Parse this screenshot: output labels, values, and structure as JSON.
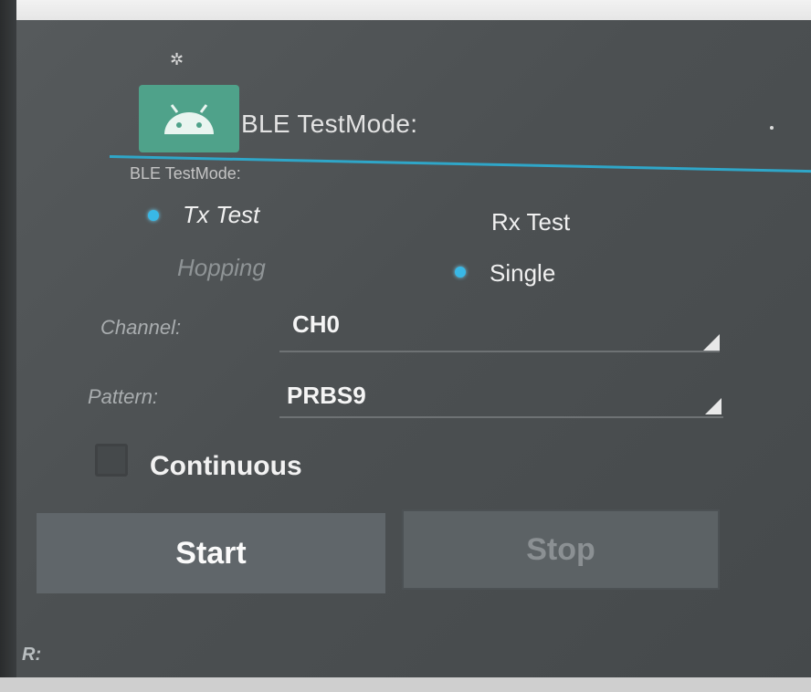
{
  "app": {
    "title": "BLE TestMode:",
    "settings_icon": "gear-icon",
    "app_icon": "android-icon"
  },
  "section": {
    "label": "BLE TestMode:"
  },
  "mode_options": [
    {
      "label": "Tx Test",
      "selected": true
    },
    {
      "label": "Rx Test",
      "selected": false
    }
  ],
  "hopping_options": [
    {
      "label": "Hopping",
      "selected": false
    },
    {
      "label": "Single",
      "selected": true
    }
  ],
  "channel": {
    "label": "Channel:",
    "value": "CH0"
  },
  "pattern": {
    "label": "Pattern:",
    "value": "PRBS9"
  },
  "continuous": {
    "label": "Continuous",
    "checked": false
  },
  "buttons": {
    "start": "Start",
    "stop": "Stop"
  },
  "status": {
    "label": "R:"
  },
  "colors": {
    "accent": "#2fa6c8",
    "radio": "#39b8e6",
    "app_icon_bg": "#4fa28a"
  }
}
